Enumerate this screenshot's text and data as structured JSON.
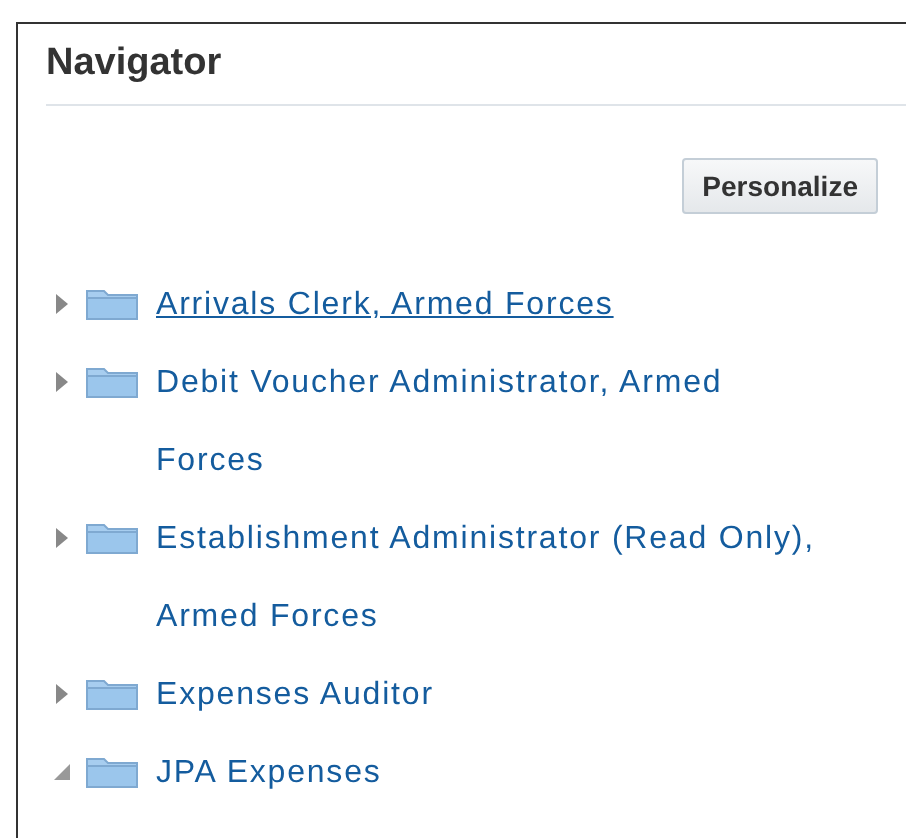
{
  "panel": {
    "title": "Navigator"
  },
  "personalize_button": "Personalize",
  "tree": [
    {
      "lines": [
        "Arrivals Clerk, Armed Forces"
      ],
      "expanded": false,
      "focused": true
    },
    {
      "lines": [
        "Debit Voucher Administrator, Armed",
        "Forces"
      ],
      "expanded": false,
      "focused": false
    },
    {
      "lines": [
        "Establishment Administrator (Read Only),",
        "Armed Forces"
      ],
      "expanded": false,
      "focused": false
    },
    {
      "lines": [
        "Expenses Auditor"
      ],
      "expanded": false,
      "focused": false
    },
    {
      "lines": [
        "JPA Expenses"
      ],
      "expanded": true,
      "focused": false
    }
  ]
}
